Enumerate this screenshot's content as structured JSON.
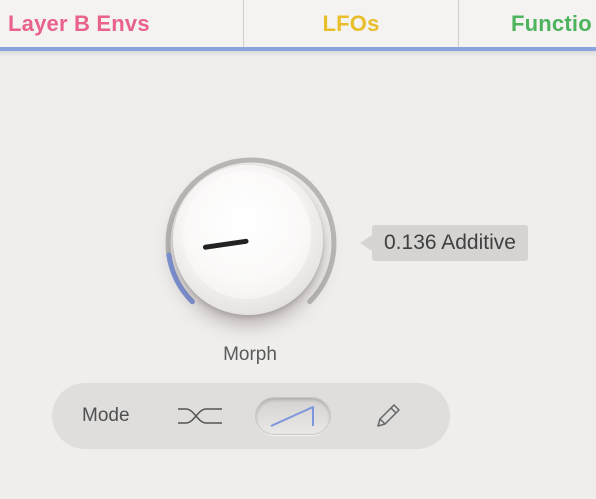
{
  "tabs": [
    {
      "label": "Layer B Envs",
      "color": "#e8628a"
    },
    {
      "label": "LFOs",
      "color": "#e8bf2a"
    },
    {
      "label": "Functio",
      "color": "#4db35d"
    }
  ],
  "knob": {
    "label": "Morph",
    "value": 0.136,
    "value_text": "0.136 Additive",
    "accent": "#7d96dc"
  },
  "mode_bar": {
    "label": "Mode",
    "buttons": [
      {
        "name": "crossfade",
        "icon": "crossfade-icon",
        "selected": false
      },
      {
        "name": "ramp",
        "icon": "ramp-icon",
        "selected": true
      },
      {
        "name": "pencil",
        "icon": "pencil-icon",
        "selected": false
      }
    ]
  }
}
